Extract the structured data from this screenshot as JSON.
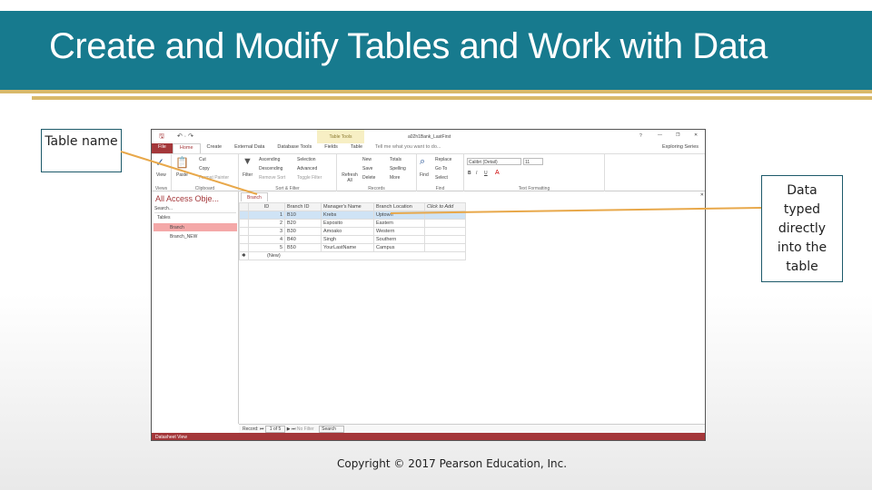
{
  "slide": {
    "title": "Create and Modify Tables and Work with Data",
    "callout_table_name": "Table name",
    "callout_data": "Data typed directly into the table",
    "copyright": "Copyright © 2017 Pearson Education, Inc.",
    "accent": "#177a8e",
    "gold": "#d9b96a"
  },
  "access": {
    "contextual": "Table Tools",
    "filename": "a02h1Bank_LastFirst",
    "help": "?",
    "series": "Exploring Series",
    "tabs": [
      "File",
      "Home",
      "Create",
      "External Data",
      "Database Tools",
      "Fields",
      "Table"
    ],
    "tell_me": "Tell me what you want to do...",
    "ribbon": {
      "views": {
        "view": "View",
        "label": "Views"
      },
      "clipboard": {
        "paste": "Paste",
        "cut": "Cut",
        "copy": "Copy",
        "format_painter": "Format Painter",
        "label": "Clipboard"
      },
      "sort": {
        "filter": "Filter",
        "ascending": "Ascending",
        "descending": "Descending",
        "remove_sort": "Remove Sort",
        "selection": "Selection",
        "advanced": "Advanced",
        "toggle": "Toggle Filter",
        "label": "Sort & Filter"
      },
      "records": {
        "refresh": "Refresh All",
        "new": "New",
        "save": "Save",
        "delete": "Delete",
        "totals": "Totals",
        "spelling": "Spelling",
        "more": "More",
        "label": "Records"
      },
      "find": {
        "find": "Find",
        "replace": "Replace",
        "goto": "Go To",
        "select": "Select",
        "label": "Find"
      },
      "text": {
        "font": "Calibri (Detail)",
        "size": "11",
        "label": "Text Formatting"
      }
    },
    "nav": {
      "title": "All Access Obje...",
      "search": "Search...",
      "section": "Tables",
      "items": [
        "Branch",
        "Branch_NEW"
      ]
    },
    "doc_tab": "Branch",
    "columns": [
      "ID",
      "Branch ID",
      "Manager's Name",
      "Branch Location",
      "Click to Add"
    ],
    "rows": [
      [
        "1",
        "B10",
        "Krebs",
        "Uptown"
      ],
      [
        "2",
        "B20",
        "Esposito",
        "Eastern"
      ],
      [
        "3",
        "B30",
        "Amoako",
        "Western"
      ],
      [
        "4",
        "B40",
        "Singh",
        "Southern"
      ],
      [
        "5",
        "B50",
        "YourLastName",
        "Campus"
      ]
    ],
    "new_row": "(New)",
    "record_nav": {
      "label": "Record:",
      "position": "1 of 5",
      "filter": "No Filter",
      "search": "Search"
    },
    "status": "Datasheet View"
  }
}
